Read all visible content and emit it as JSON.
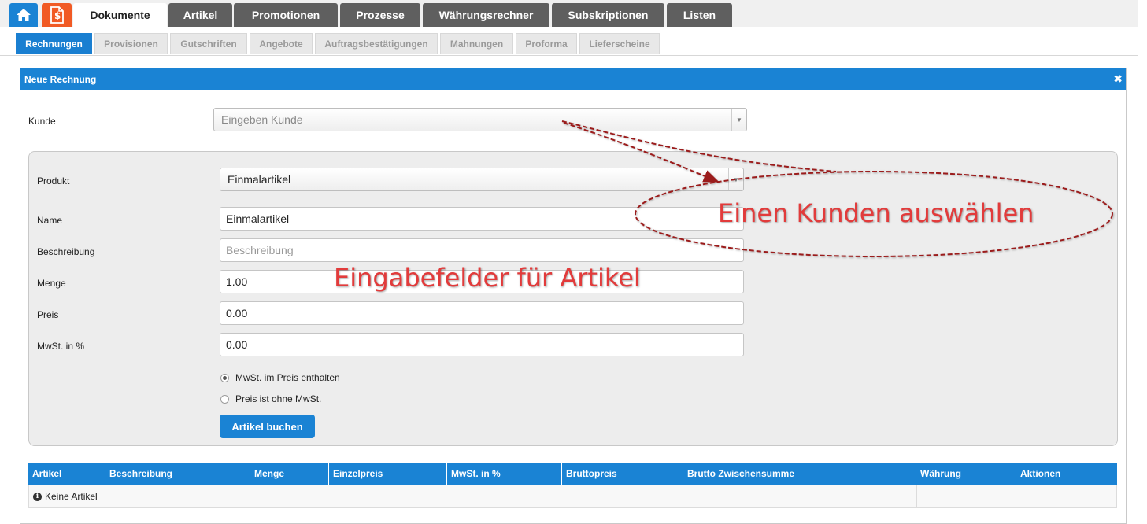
{
  "nav": {
    "home_icon": "home-icon",
    "doc_icon": "invoice-dollar-icon",
    "tabs": [
      {
        "label": "Dokumente",
        "active": true
      },
      {
        "label": "Artikel",
        "active": false
      },
      {
        "label": "Promotionen",
        "active": false
      },
      {
        "label": "Prozesse",
        "active": false
      },
      {
        "label": "Währungsrechner",
        "active": false
      },
      {
        "label": "Subskriptionen",
        "active": false
      },
      {
        "label": "Listen",
        "active": false
      }
    ]
  },
  "subnav": {
    "tabs": [
      {
        "label": "Rechnungen",
        "active": true
      },
      {
        "label": "Provisionen",
        "active": false
      },
      {
        "label": "Gutschriften",
        "active": false
      },
      {
        "label": "Angebote",
        "active": false
      },
      {
        "label": "Auftragsbestätigungen",
        "active": false
      },
      {
        "label": "Mahnungen",
        "active": false
      },
      {
        "label": "Proforma",
        "active": false
      },
      {
        "label": "Lieferscheine",
        "active": false
      }
    ]
  },
  "panel": {
    "title": "Neue Rechnung",
    "close_glyph": "✖",
    "customer": {
      "label": "Kunde",
      "placeholder": "Eingeben Kunde"
    },
    "product": {
      "label": "Produkt",
      "selected": "Einmalartikel",
      "name": {
        "label": "Name",
        "value": "Einmalartikel"
      },
      "description": {
        "label": "Beschreibung",
        "placeholder": "Beschreibung"
      },
      "quantity": {
        "label": "Menge",
        "value": "1.00"
      },
      "price": {
        "label": "Preis",
        "value": "0.00"
      },
      "vat": {
        "label": "MwSt. in %",
        "value": "0.00"
      },
      "vat_options": [
        {
          "label": "MwSt. im Preis enthalten",
          "checked": true
        },
        {
          "label": "Preis ist ohne MwSt.",
          "checked": false
        }
      ],
      "submit_label": "Artikel buchen"
    },
    "table": {
      "columns": [
        "Artikel",
        "Beschreibung",
        "Menge",
        "Einzelpreis",
        "MwSt. in %",
        "Bruttopreis",
        "Brutto Zwischensumme",
        "Währung",
        "Aktionen"
      ],
      "empty_text": "Keine Artikel"
    }
  },
  "annotations": {
    "select_customer": "Einen Kunden auswählen",
    "article_fields": "Eingabefelder für Artikel"
  },
  "colors": {
    "primary": "#1a83d4",
    "orange": "#f15a24",
    "tab_dark": "#5f5f5f",
    "annotation_red": "#e23b3b",
    "annotation_line": "#9b1c1c"
  }
}
